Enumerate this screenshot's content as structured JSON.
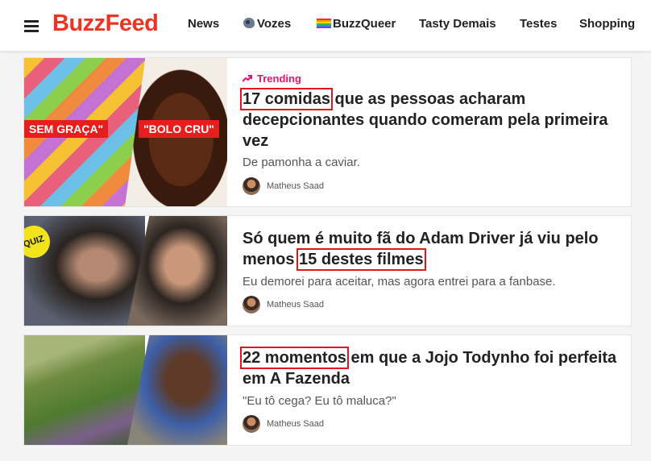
{
  "header": {
    "logo": "BuzzFeed",
    "nav": [
      {
        "label": "News"
      },
      {
        "label": "Vozes"
      },
      {
        "label": "BuzzQueer"
      },
      {
        "label": "Tasty Demais"
      },
      {
        "label": "Testes"
      },
      {
        "label": "Shopping"
      }
    ]
  },
  "colors": {
    "brand": "#ee3322",
    "trending": "#e4136f",
    "highlight": "#e0151b",
    "quiz": "#f3e31b"
  },
  "articles": [
    {
      "badge": "Trending",
      "title_highlight": "17 comidas",
      "title_rest": " que as pessoas acharam decepcionantes quando comeram pela primeira vez",
      "description": "De pamonha a caviar.",
      "author": "Matheus Saad",
      "image_labels": [
        "SEM GRAÇA\"",
        "\"BOLO CRU\""
      ]
    },
    {
      "title_pre": "Só quem é muito fã do Adam Driver já viu pelo menos ",
      "title_highlight": "15 destes filmes",
      "description": "Eu demorei para aceitar, mas agora entrei para a fanbase.",
      "author": "Matheus Saad",
      "image_badge": "QUIZ"
    },
    {
      "title_highlight": "22 momentos",
      "title_rest": " em que a Jojo Todynho foi perfeita em A Fazenda",
      "description": "\"Eu tô cega? Eu tô maluca?\"",
      "author": "Matheus Saad"
    }
  ]
}
